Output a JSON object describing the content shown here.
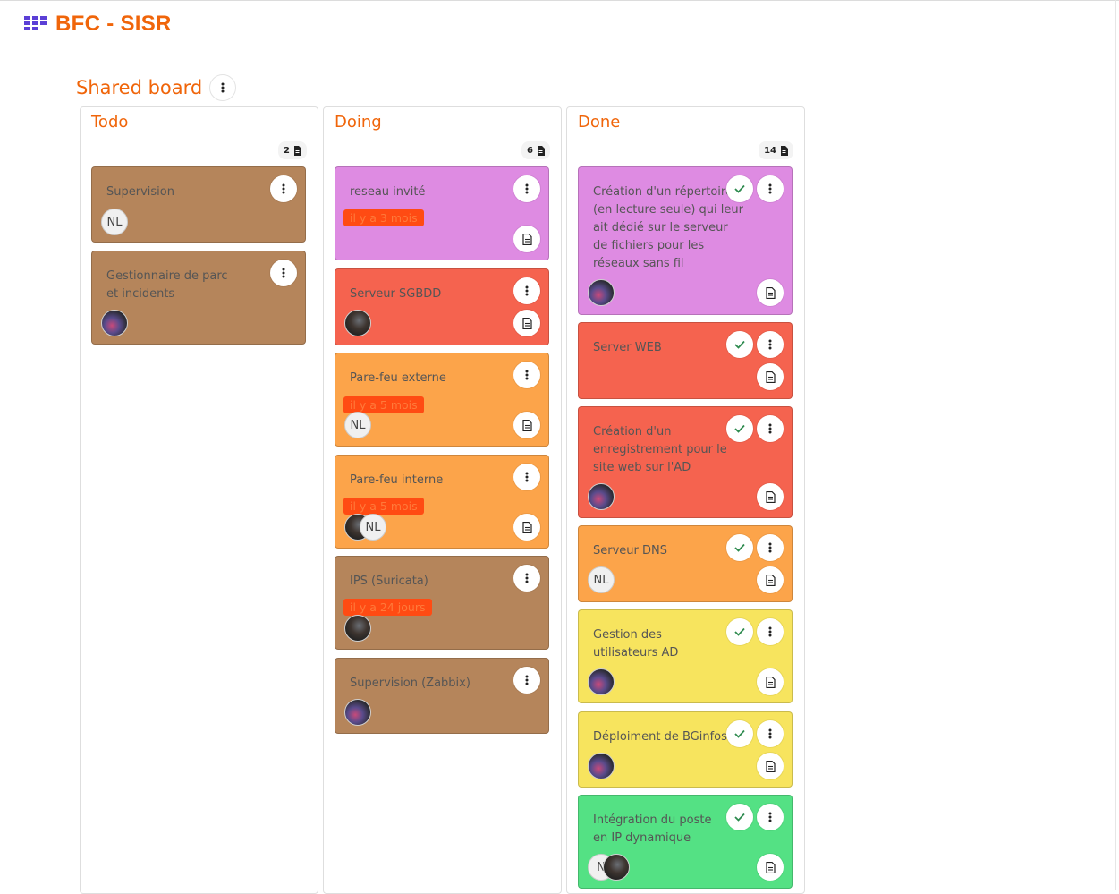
{
  "app": {
    "title": "BFC - SISR"
  },
  "board": {
    "title": "Shared board"
  },
  "colors": {
    "brown": "#b5855b",
    "violet": "#de8be2",
    "red": "#f5634f",
    "orange": "#fca44a",
    "yellow": "#f7e45e",
    "green": "#54e184",
    "due": "#ff4b13",
    "accent": "#f0650a"
  },
  "columns": [
    {
      "name": "Todo",
      "count": "2",
      "cards": [
        {
          "title": "Supervision",
          "assignees": [
            "NL"
          ]
        },
        {
          "title": "Gestionnaire de parc et incidents"
        }
      ]
    },
    {
      "name": "Doing",
      "count": "6",
      "cards": [
        {
          "title": "reseau invité",
          "due": "il y a 3 mois"
        },
        {
          "title": "Serveur SGBDD"
        },
        {
          "title": "Pare-feu externe",
          "due": "il y a 5 mois",
          "assignees": [
            "NL"
          ]
        },
        {
          "title": "Pare-feu interne",
          "due": "il y a 5 mois",
          "assignees": [
            "NL"
          ]
        },
        {
          "title": "IPS (Suricata)",
          "due": "il y a 24 jours"
        },
        {
          "title": "Supervision (Zabbix)"
        }
      ]
    },
    {
      "name": "Done",
      "count": "14",
      "cards": [
        {
          "title": "Création d'un répertoire (en lecture seule) qui leur ait dédié sur le serveur de fichiers pour les réseaux sans fil"
        },
        {
          "title": "Server WEB"
        },
        {
          "title": "Création d'un enregistrement pour le site web sur l'AD"
        },
        {
          "title": "Serveur DNS",
          "assignees": [
            "NL"
          ]
        },
        {
          "title": "Gestion des utilisateurs AD"
        },
        {
          "title": "Déploiment de BGinfos"
        },
        {
          "title": "Intégration du poste en IP dynamique",
          "assignees": [
            "N"
          ]
        }
      ]
    }
  ],
  "icons": {
    "menu": "dots-vertical-icon",
    "notes": "document-icon",
    "done": "check-icon",
    "logo": "grid-logo-icon"
  }
}
